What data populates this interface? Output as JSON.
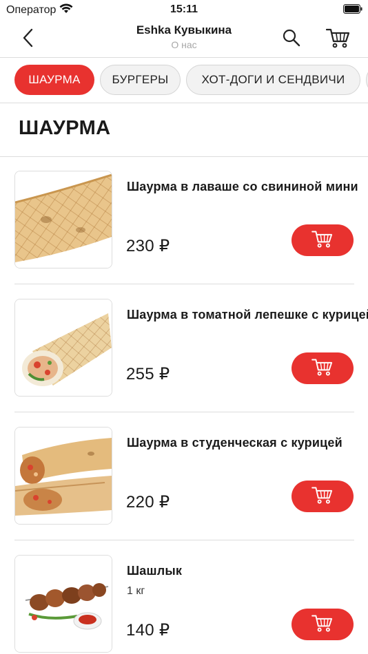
{
  "status_bar": {
    "carrier": "Оператор",
    "time": "15:11",
    "icons": [
      "wifi-icon",
      "battery-icon"
    ]
  },
  "nav": {
    "title": "Eshka Кувыкина",
    "subtitle": "О нас",
    "icons": [
      "back-chevron-icon",
      "search-icon",
      "cart-icon"
    ]
  },
  "categories": [
    {
      "label": "ШАУРМА",
      "active": true
    },
    {
      "label": "БУРГЕРЫ",
      "active": false
    },
    {
      "label": "ХОТ-ДОГИ И СЕНДВИЧИ",
      "active": false
    }
  ],
  "section": {
    "title": "ШАУРМА"
  },
  "products": [
    {
      "name": "Шаурма в лаваше со свининой мини",
      "description": "",
      "price": "230 ₽",
      "image": "shawarma-roll-image"
    },
    {
      "name": "Шаурма в томатной лепешке с курицей",
      "description": "",
      "price": "255 ₽",
      "image": "shawarma-wrap-image"
    },
    {
      "name": "Шаурма в студенческая с курицей",
      "description": "",
      "price": "220 ₽",
      "image": "shawarma-halves-image"
    },
    {
      "name": "Шашлык",
      "description": "1 кг",
      "price": "140 ₽",
      "image": "shashlik-image"
    }
  ],
  "colors": {
    "accent": "#e8322f",
    "chip_bg": "#f2f2f2",
    "separator": "#dcdcdc",
    "subtitle": "#a7a7a7"
  }
}
